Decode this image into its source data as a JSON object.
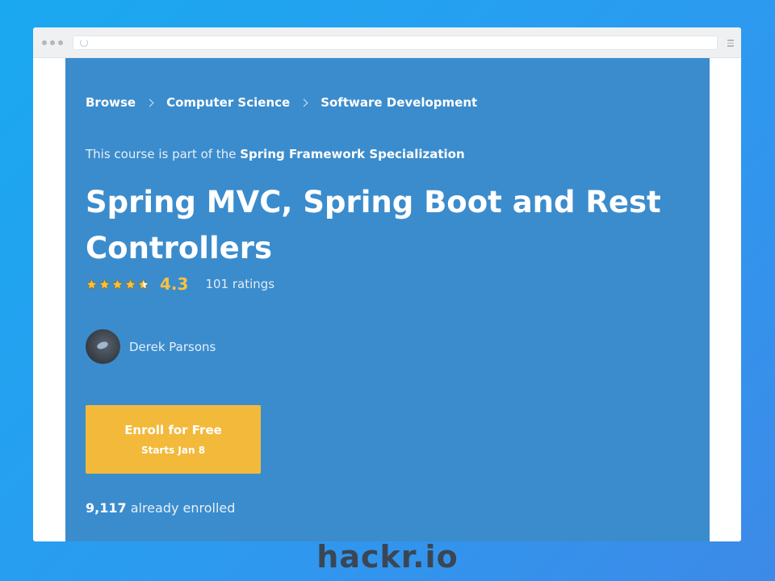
{
  "breadcrumb": {
    "items": [
      "Browse",
      "Computer Science",
      "Software Development"
    ]
  },
  "course": {
    "spec_prefix": "This course is part of the ",
    "spec_name": "Spring Framework Specialization",
    "title": "Spring MVC, Spring Boot and Rest Controllers",
    "rating": "4.3",
    "rating_stars": 4.5,
    "ratings_count": "101 ratings",
    "instructor": "Derek Parsons",
    "enroll_label": "Enroll for Free",
    "enroll_sub": "Starts Jan 8",
    "enrolled_count": "9,117",
    "enrolled_suffix": " already enrolled"
  },
  "colors": {
    "background": "#1aa9f0",
    "panel": "#3b8ccd",
    "accent": "#f3b93b",
    "rating": "#f5c242"
  },
  "icons": {
    "star": "star-icon",
    "half_star": "star-half-icon",
    "chevron": "chevron-right-icon"
  },
  "watermark": "hackr.io"
}
